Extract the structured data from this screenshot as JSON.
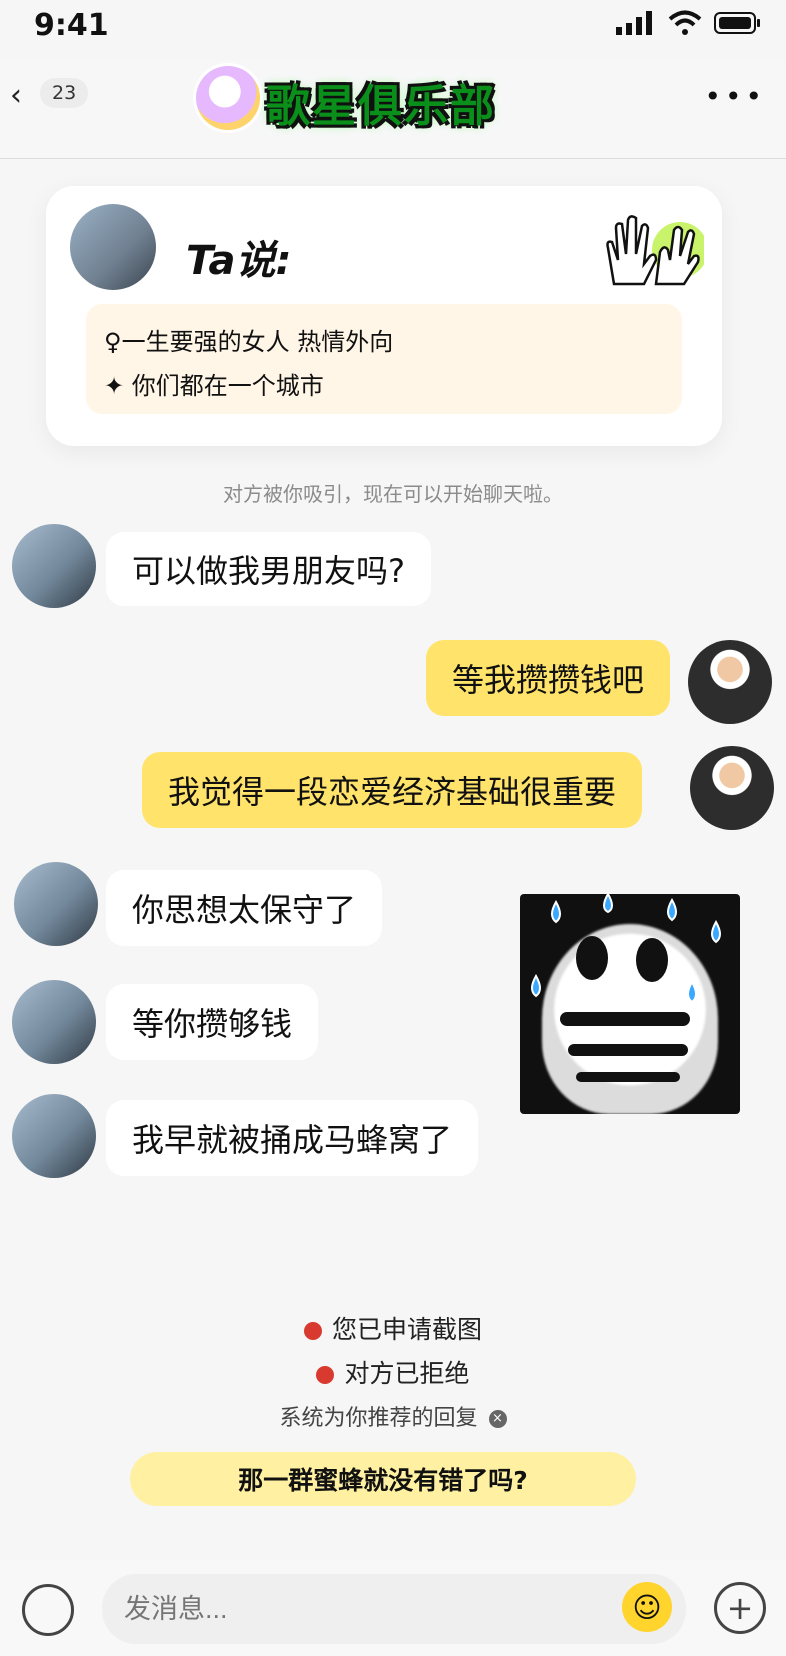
{
  "status_bar": {
    "time": "9:41"
  },
  "header": {
    "back_label": "‹",
    "unread_count": "23",
    "title": "歌星俱乐部",
    "menu_label": "•••"
  },
  "profile_card": {
    "title": "Ta说:",
    "info": [
      "♀一生要强的女人  热情外向",
      "✦ 你们都在一个城市"
    ]
  },
  "system_note": "对方被你吸引，现在可以开始聊天啦。",
  "messages": [
    {
      "side": "in",
      "text": "可以做我男朋友吗?"
    },
    {
      "side": "out",
      "text": "等我攒攒钱吧"
    },
    {
      "side": "out",
      "text": "我觉得一段恋爱经济基础很重要"
    },
    {
      "side": "in",
      "text": "你思想太保守了"
    },
    {
      "side": "in",
      "text": "等你攒够钱"
    },
    {
      "side": "in",
      "text": "我早就被捅成马蜂窝了"
    }
  ],
  "notices": {
    "screenshot_request": "您已申请截图",
    "rejected": "对方已拒绝",
    "recommended_label": "系统为你推荐的回复",
    "suggested_reply": "那一群蜜蜂就没有错了吗?"
  },
  "input": {
    "placeholder": "发消息...",
    "emoji_icon": "☺",
    "plus_icon": "+"
  },
  "colors": {
    "outgoing_bubble": "#ffe36a",
    "incoming_bubble": "#ffffff",
    "title_green": "#0b8f1b",
    "notice_red": "#d83a2f"
  }
}
